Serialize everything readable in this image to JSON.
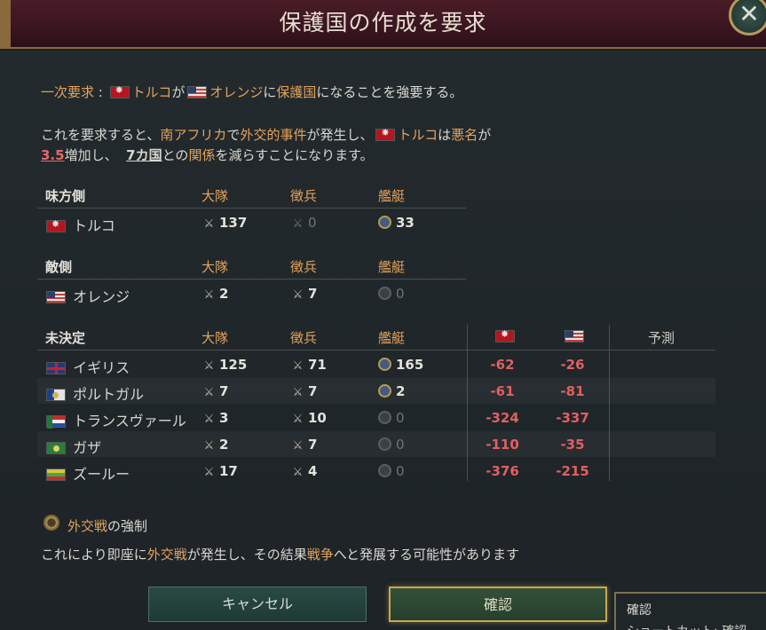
{
  "dialog": {
    "title": "保護国の作成を要求",
    "close_symbol": "✕"
  },
  "primary_demand": {
    "label": "一次要求",
    "colon": " : ",
    "actor": "トルコ",
    "particle1": "が",
    "target": "オレンジ",
    "particle2": "に",
    "status": "保護国",
    "rest": "になることを強要する。"
  },
  "consequence": {
    "p1": "これを要求すると、",
    "region": "南アフリカ",
    "p2": "で",
    "event": "外交的事件",
    "p3": "が発生し、",
    "actor": "トルコ",
    "p4": "は",
    "infamy": "悪名",
    "p5": "が",
    "infamy_value": "3.5",
    "p6": "増加し、",
    "countries": "7カ国",
    "p7": "との",
    "relations": "関係",
    "p8": "を減らすことになります。"
  },
  "columns": {
    "battalions": "大隊",
    "conscripts": "徴兵",
    "flotillas": "艦艇",
    "prediction": "予測"
  },
  "allies": {
    "header": "味方側",
    "rows": [
      {
        "name": "トルコ",
        "flag": "turkey",
        "battalions": "137",
        "conscripts": "0",
        "flotillas": "33"
      }
    ]
  },
  "enemies": {
    "header": "敵側",
    "rows": [
      {
        "name": "オレンジ",
        "flag": "orange",
        "battalions": "2",
        "conscripts": "7",
        "flotillas": "0"
      }
    ]
  },
  "undecided": {
    "header": "未決定",
    "rows": [
      {
        "name": "イギリス",
        "flag": "uk",
        "battalions": "125",
        "conscripts": "71",
        "flotillas": "165",
        "rel_turkey": "-62",
        "rel_orange": "-26"
      },
      {
        "name": "ポルトガル",
        "flag": "portugal",
        "battalions": "7",
        "conscripts": "7",
        "flotillas": "2",
        "rel_turkey": "-61",
        "rel_orange": "-81"
      },
      {
        "name": "トランスヴァール",
        "flag": "transvaal",
        "battalions": "3",
        "conscripts": "10",
        "flotillas": "0",
        "rel_turkey": "-324",
        "rel_orange": "-337"
      },
      {
        "name": "ガザ",
        "flag": "gaza",
        "battalions": "2",
        "conscripts": "7",
        "flotillas": "0",
        "rel_turkey": "-110",
        "rel_orange": "-35"
      },
      {
        "name": "ズールー",
        "flag": "zulu",
        "battalions": "17",
        "conscripts": "4",
        "flotillas": "0",
        "rel_turkey": "-376",
        "rel_orange": "-215"
      }
    ]
  },
  "force_war": {
    "label_hl": "外交戦",
    "label_rest": "の強制",
    "desc1": "これにより即座に",
    "desc_hl1": "外交戦",
    "desc2": "が発生し、その結果",
    "desc_hl2": "戦争",
    "desc3": "へと発展する可能性があります"
  },
  "buttons": {
    "cancel": "キャンセル",
    "confirm": "確認"
  },
  "tooltip": {
    "title": "確認",
    "line2": "ショートカット: 確認"
  },
  "colors": {
    "highlight": "#e5a35b",
    "negative": "#e5696a",
    "header_bg": "#3a1520"
  }
}
